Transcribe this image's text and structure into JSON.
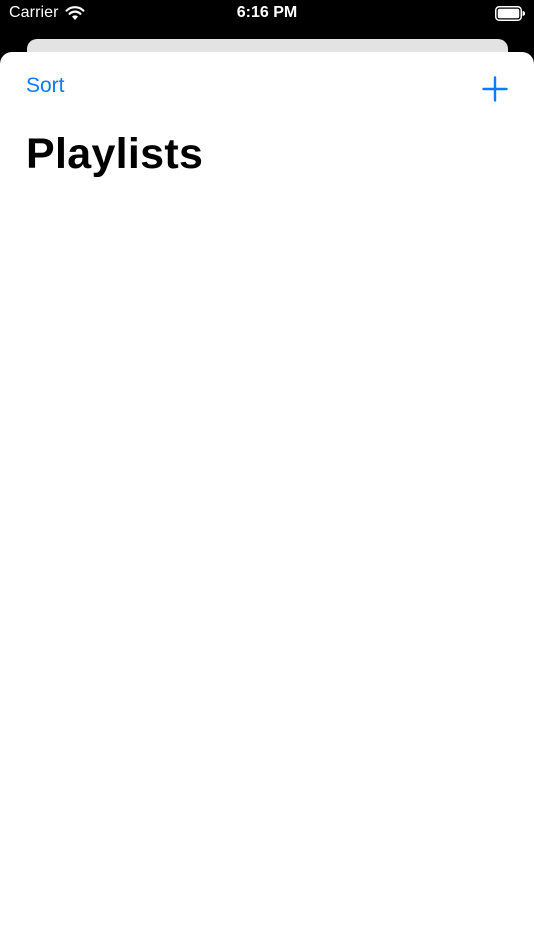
{
  "status_bar": {
    "carrier": "Carrier",
    "time": "6:16 PM",
    "icons": [
      "wifi-icon",
      "battery-icon"
    ]
  },
  "nav": {
    "sort_label": "Sort",
    "add_icon": "plus-icon"
  },
  "page": {
    "title": "Playlists"
  },
  "playlists": [],
  "colors": {
    "accent": "#0a7aff",
    "background": "#ffffff",
    "status_bar_bg": "#000000",
    "back_card": "#e3e3e3"
  }
}
